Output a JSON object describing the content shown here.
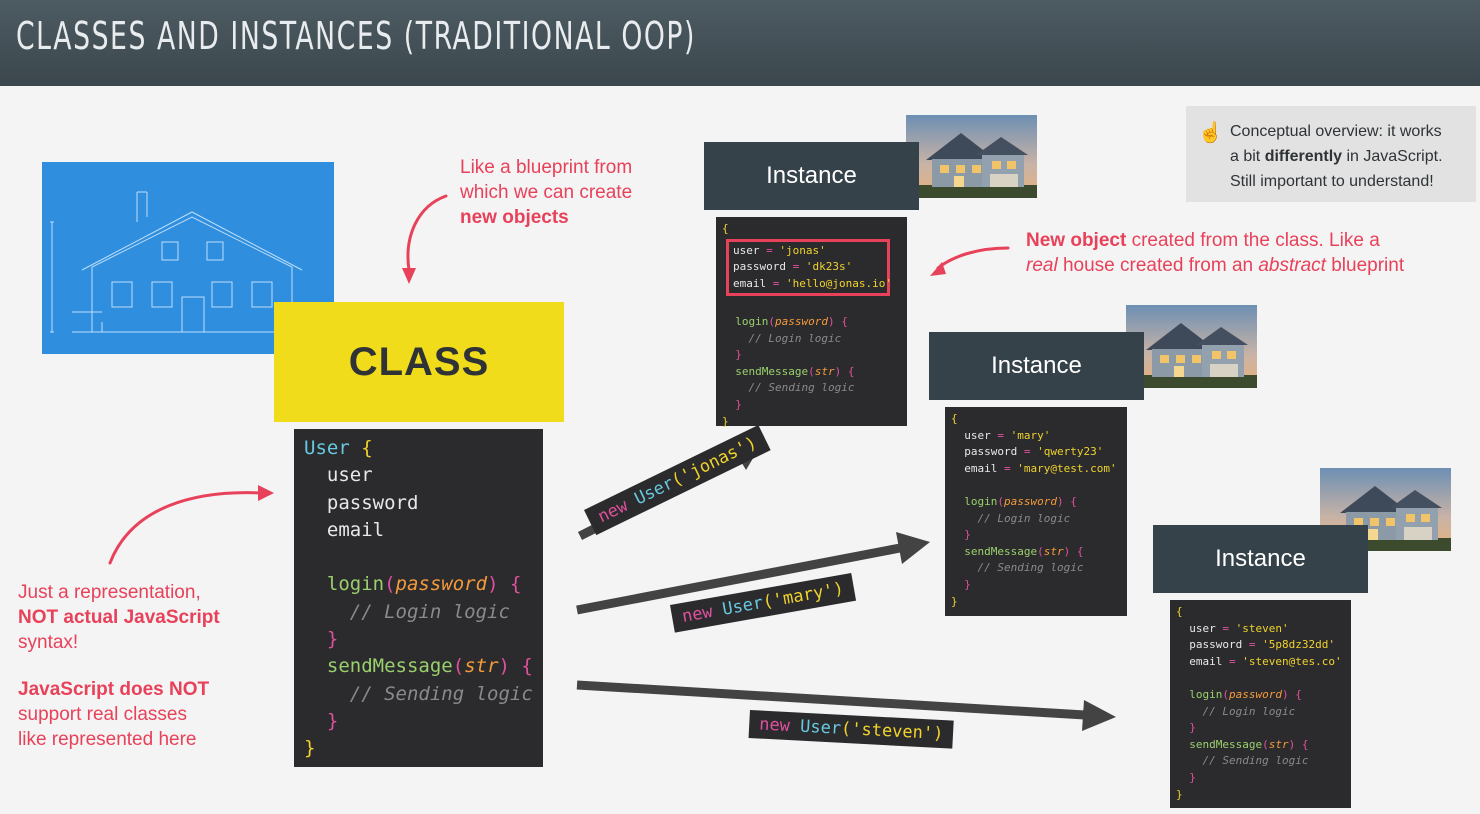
{
  "header": {
    "title": "CLASSES AND INSTANCES (TRADITIONAL OOP)"
  },
  "class_label": "CLASS",
  "notes": {
    "blueprint": [
      "Like a blueprint from",
      "which we can create",
      "new objects"
    ],
    "representation": [
      "Just a representation,",
      "NOT actual JavaScript",
      "syntax!"
    ],
    "real_classes": [
      "JavaScript does NOT",
      "support real classes",
      "like represented here"
    ],
    "new_object": {
      "line1_bold": "New object",
      "line1_rest": " created from the class. Like a",
      "line2_a": "real",
      "line2_b": " house created from an ",
      "line2_c": "abstract",
      "line2_d": " blueprint"
    }
  },
  "callout": {
    "icon": "pointing-hand-icon",
    "lines": [
      "Conceptual overview: it works",
      "a bit differently in JavaScript.",
      "Still important to understand!"
    ],
    "bold_word": "differently"
  },
  "main_code": {
    "class_name": "User",
    "props": [
      "user",
      "password",
      "email"
    ],
    "method1": "login",
    "param1": "password",
    "comment1": "// Login logic",
    "method2": "sendMessage",
    "param2": "str",
    "comment2": "// Sending logic"
  },
  "instances": [
    {
      "label": "Instance",
      "user": "'jonas'",
      "password": "'dk23s'",
      "email": "'hello@jonas.io'",
      "arrow_label_new": "new",
      "arrow_label_class": "User",
      "arrow_label_arg": "'jonas'"
    },
    {
      "label": "Instance",
      "user": "'mary'",
      "password": "'qwerty23'",
      "email": "'mary@test.com'",
      "arrow_label_new": "new",
      "arrow_label_class": "User",
      "arrow_label_arg": "'mary'"
    },
    {
      "label": "Instance",
      "user": "'steven'",
      "password": "'5p8dz32dd'",
      "email": "'steven@tes.co'",
      "arrow_label_new": "new",
      "arrow_label_class": "User",
      "arrow_label_arg": "'steven'"
    }
  ],
  "inst_code": {
    "k_user": "user",
    "k_password": "password",
    "k_email": "email",
    "eq": " = ",
    "m1": "login",
    "p1": "password",
    "c1": "// Login logic",
    "m2": "sendMessage",
    "p2": "str",
    "c2": "// Sending logic"
  },
  "colors": {
    "accent": "#e8415a",
    "class_bg": "#f0dc1b",
    "header_bg": "#3b474d",
    "instance_label_bg": "#354249",
    "code_bg": "#2b2b2e",
    "highlight_box": "#e8415a"
  }
}
